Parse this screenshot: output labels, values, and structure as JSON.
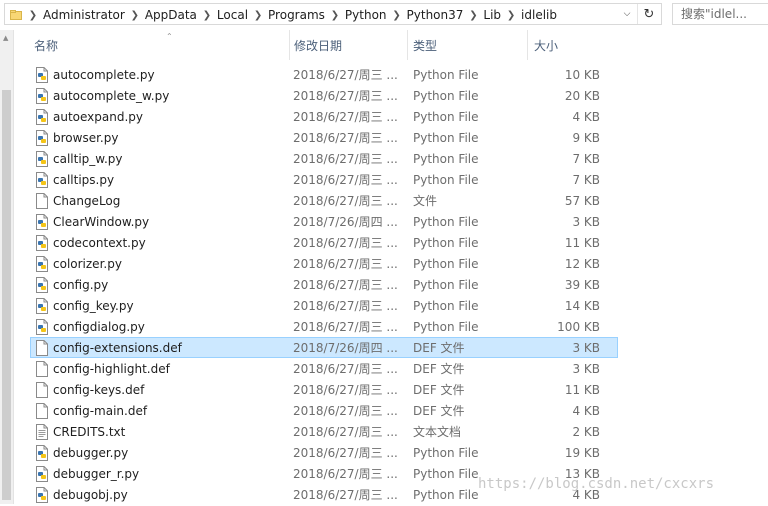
{
  "address": {
    "crumbs": [
      "Administrator",
      "AppData",
      "Local",
      "Programs",
      "Python",
      "Python37",
      "Lib",
      "idlelib"
    ]
  },
  "search": {
    "placeholder": "搜索\"idlel..."
  },
  "columns": {
    "name": "名称",
    "date": "修改日期",
    "type": "类型",
    "size": "大小"
  },
  "files": [
    {
      "name": "autocomplete.py",
      "date": "2018/6/27/周三 ...",
      "type": "Python File",
      "size": "10 KB",
      "icon": "python-file-icon"
    },
    {
      "name": "autocomplete_w.py",
      "date": "2018/6/27/周三 ...",
      "type": "Python File",
      "size": "20 KB",
      "icon": "python-file-icon"
    },
    {
      "name": "autoexpand.py",
      "date": "2018/6/27/周三 ...",
      "type": "Python File",
      "size": "4 KB",
      "icon": "python-file-icon"
    },
    {
      "name": "browser.py",
      "date": "2018/6/27/周三 ...",
      "type": "Python File",
      "size": "9 KB",
      "icon": "python-file-icon"
    },
    {
      "name": "calltip_w.py",
      "date": "2018/6/27/周三 ...",
      "type": "Python File",
      "size": "7 KB",
      "icon": "python-file-icon"
    },
    {
      "name": "calltips.py",
      "date": "2018/6/27/周三 ...",
      "type": "Python File",
      "size": "7 KB",
      "icon": "python-file-icon"
    },
    {
      "name": "ChangeLog",
      "date": "2018/6/27/周三 ...",
      "type": "文件",
      "size": "57 KB",
      "icon": "blank-file-icon"
    },
    {
      "name": "ClearWindow.py",
      "date": "2018/7/26/周四 ...",
      "type": "Python File",
      "size": "3 KB",
      "icon": "python-file-icon"
    },
    {
      "name": "codecontext.py",
      "date": "2018/6/27/周三 ...",
      "type": "Python File",
      "size": "11 KB",
      "icon": "python-file-icon"
    },
    {
      "name": "colorizer.py",
      "date": "2018/6/27/周三 ...",
      "type": "Python File",
      "size": "12 KB",
      "icon": "python-file-icon"
    },
    {
      "name": "config.py",
      "date": "2018/6/27/周三 ...",
      "type": "Python File",
      "size": "39 KB",
      "icon": "python-file-icon"
    },
    {
      "name": "config_key.py",
      "date": "2018/6/27/周三 ...",
      "type": "Python File",
      "size": "14 KB",
      "icon": "python-file-icon"
    },
    {
      "name": "configdialog.py",
      "date": "2018/6/27/周三 ...",
      "type": "Python File",
      "size": "100 KB",
      "icon": "python-file-icon"
    },
    {
      "name": "config-extensions.def",
      "date": "2018/7/26/周四 ...",
      "type": "DEF 文件",
      "size": "3 KB",
      "icon": "blank-file-icon",
      "selected": true
    },
    {
      "name": "config-highlight.def",
      "date": "2018/6/27/周三 ...",
      "type": "DEF 文件",
      "size": "3 KB",
      "icon": "blank-file-icon"
    },
    {
      "name": "config-keys.def",
      "date": "2018/6/27/周三 ...",
      "type": "DEF 文件",
      "size": "11 KB",
      "icon": "blank-file-icon"
    },
    {
      "name": "config-main.def",
      "date": "2018/6/27/周三 ...",
      "type": "DEF 文件",
      "size": "4 KB",
      "icon": "blank-file-icon"
    },
    {
      "name": "CREDITS.txt",
      "date": "2018/6/27/周三 ...",
      "type": "文本文档",
      "size": "2 KB",
      "icon": "text-file-icon"
    },
    {
      "name": "debugger.py",
      "date": "2018/6/27/周三 ...",
      "type": "Python File",
      "size": "19 KB",
      "icon": "python-file-icon"
    },
    {
      "name": "debugger_r.py",
      "date": "2018/6/27/周三 ...",
      "type": "Python File",
      "size": "13 KB",
      "icon": "python-file-icon"
    },
    {
      "name": "debugobj.py",
      "date": "2018/6/27/周三 ...",
      "type": "Python File",
      "size": "4 KB",
      "icon": "python-file-icon"
    }
  ],
  "watermark": "https://blog.csdn.net/cxcxrs",
  "colors": {
    "selection_bg": "#cce8ff",
    "selection_border": "#99d1ff",
    "header_text": "#4c607a",
    "secondary_text": "#6d6d6d"
  }
}
